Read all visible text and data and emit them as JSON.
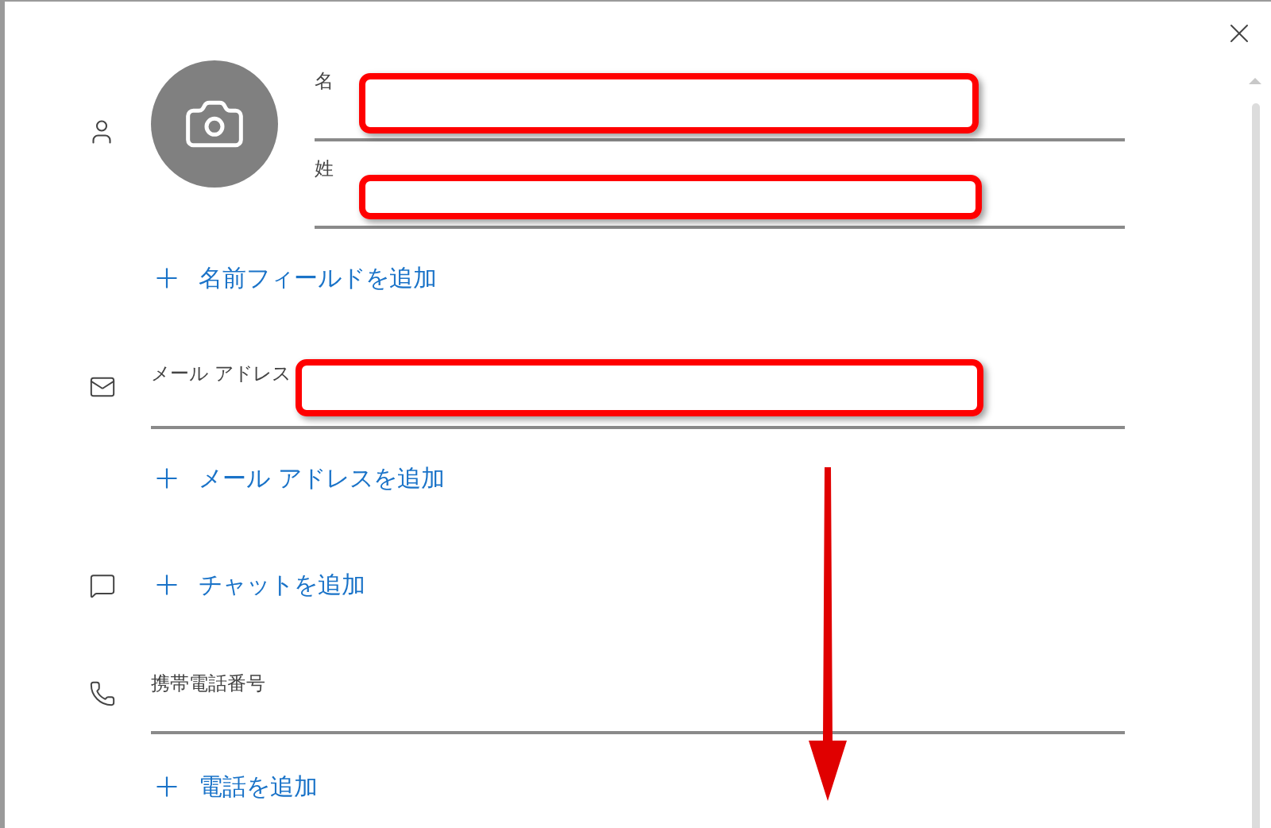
{
  "name_fields": [
    {
      "label": "名"
    },
    {
      "label": "姓"
    }
  ],
  "add_name": {
    "label": "名前フィールドを追加"
  },
  "email_field": {
    "label": "メール アドレス"
  },
  "add_email": {
    "label": "メール アドレスを追加"
  },
  "add_chat": {
    "label": "チャットを追加"
  },
  "phone_field": {
    "label": "携帯電話番号"
  },
  "add_phone": {
    "label": "電話を追加"
  }
}
